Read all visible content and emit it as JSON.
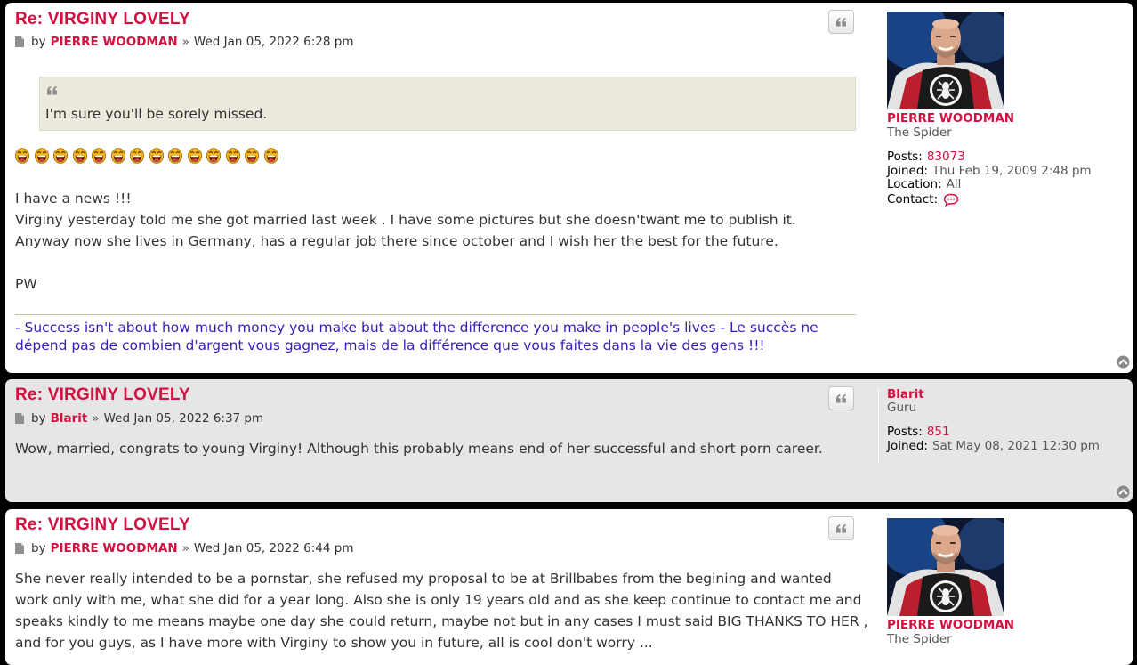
{
  "posts": [
    {
      "title": "Re: VIRGINY LOVELY",
      "by": "by",
      "author": "PIERRE WOODMAN",
      "sep": "»",
      "date": "Wed Jan 05, 2022 6:28 pm",
      "quote": "I'm sure you'll be sorely missed.",
      "emoji_count": 14,
      "lines": [
        "I have a news !!!",
        "Virginy yesterday told me she got married last week . I have some pictures but she doesn'twant me to publish it.",
        "Anyway now she lives in Germany, has a regular job there since october and I wish her the best for the future.",
        "PW"
      ],
      "signature": "- Success isn't about how much money you make but about the difference you make in people's lives - Le succès ne dépend pas de combien d'argent vous gagnez, mais de la différence que vous faites dans la vie des gens !!!",
      "profile": {
        "name": "PIERRE WOODMAN",
        "rank": "The Spider",
        "posts_label": "Posts:",
        "posts": "83073",
        "joined_label": "Joined:",
        "joined": "Thu Feb 19, 2009 2:48 pm",
        "location_label": "Location:",
        "location": "All",
        "contact_label": "Contact:"
      }
    },
    {
      "title": "Re: VIRGINY LOVELY",
      "by": "by",
      "author": "Blarit",
      "sep": "»",
      "date": "Wed Jan 05, 2022 6:37 pm",
      "text": "Wow, married, congrats to young Virginy! Although this probably means end of her successful and short porn career.",
      "profile": {
        "name": "Blarit",
        "rank": "Guru",
        "posts_label": "Posts:",
        "posts": "851",
        "joined_label": "Joined:",
        "joined": "Sat May 08, 2021 12:30 pm"
      }
    },
    {
      "title": "Re: VIRGINY LOVELY",
      "by": "by",
      "author": "PIERRE WOODMAN",
      "sep": "»",
      "date": "Wed Jan 05, 2022 6:44 pm",
      "lines": [
        "She never really intended to be a pornstar, she refused my proposal to be at Brillbabes from the begining and wanted",
        "work only with me, what she did for a year long. Also she is only 19 years old and as she keep continue to contact me and",
        "speaks kindly to me means maybe one day she could return, maybe not but in any cases I must said BIG THANKS TO HER ,",
        "and for you guys, as I have more with Virginy to show you in future, all is cool don't worry ..."
      ],
      "profile": {
        "name": "PIERRE WOODMAN",
        "rank": "The Spider"
      }
    }
  ],
  "colors": {
    "link_red": "#d31141",
    "signature_blue": "#3a1cbd",
    "quote_bg": "#ebeadd",
    "post_white": "#ffffff",
    "post_grey": "#e6e6e6"
  },
  "icons": [
    "post-icon",
    "quote-icon",
    "back-to-top-icon",
    "contact-icon",
    "laughing-emoji"
  ]
}
